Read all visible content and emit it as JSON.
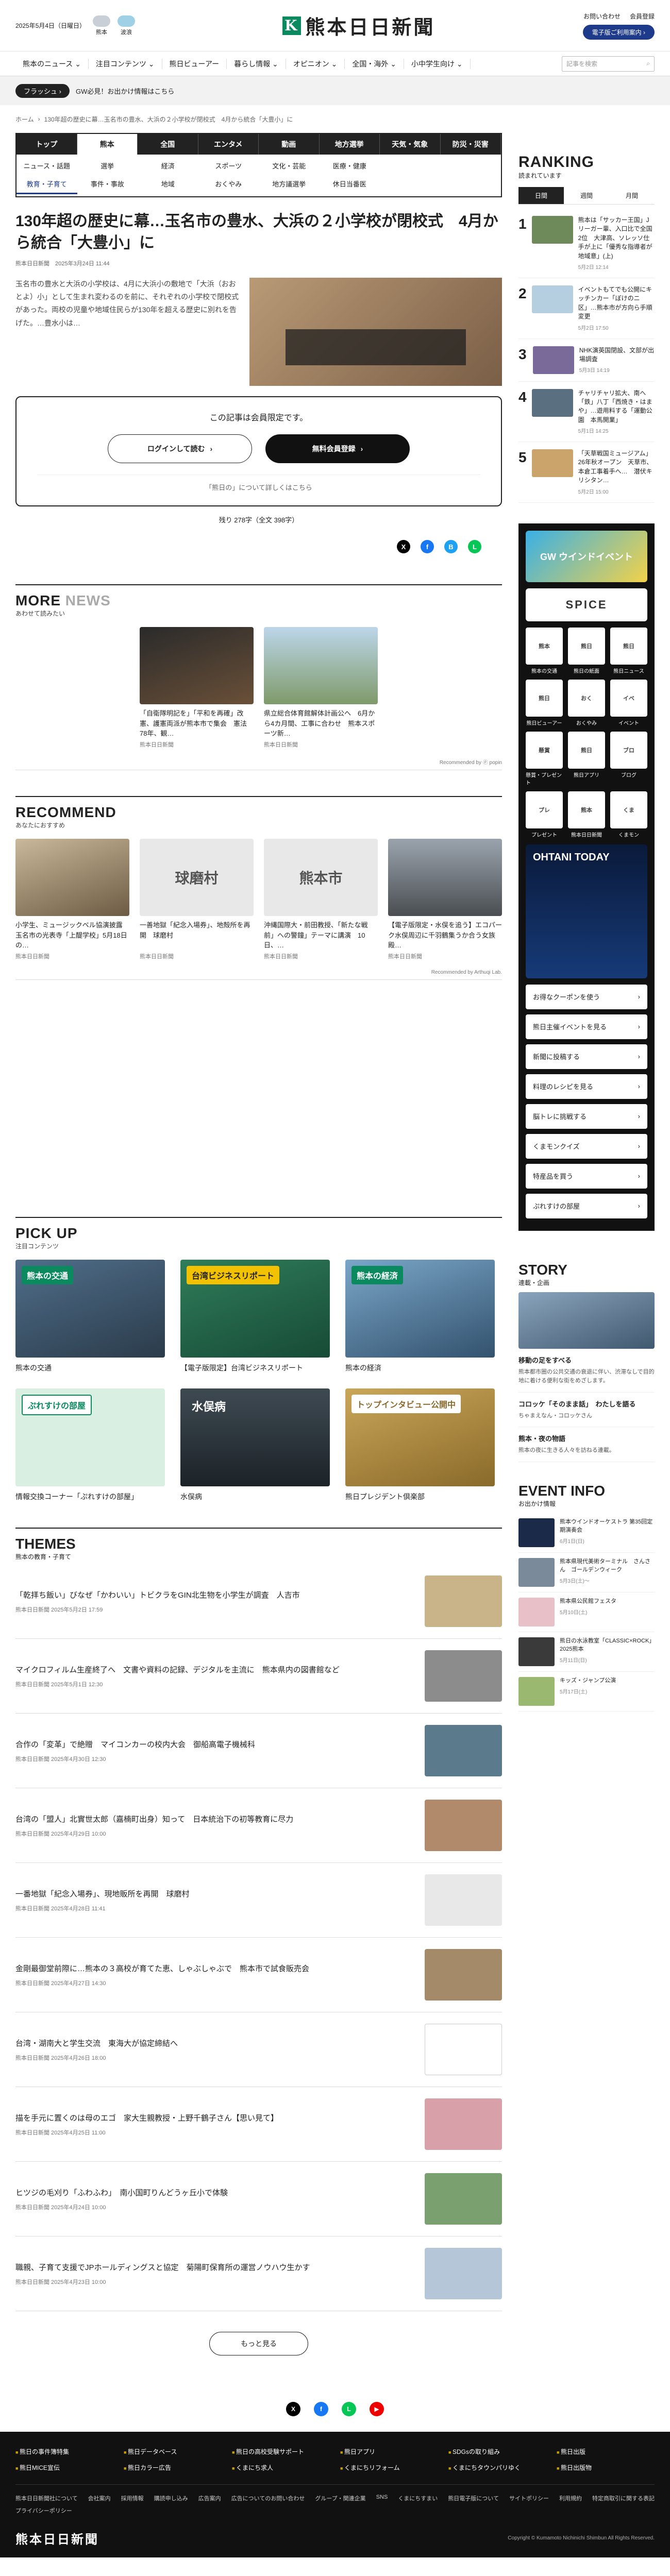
{
  "header": {
    "date": "2025年5月4日（日曜日）",
    "weather_label": "熊本",
    "weather2": "波浪",
    "logo_text": "熊本日日新聞",
    "links": [
      "お問い合わせ",
      "会員登録"
    ],
    "paper_btn": "電子版ご利用案内 ›"
  },
  "gnav": {
    "items": [
      "熊本のニュース ⌄",
      "注目コンテンツ ⌄",
      "熊日ビューアー",
      "暮らし情報 ⌄",
      "オピニオン ⌄",
      "全国・海外 ⌄",
      "小中学生向け ⌄"
    ],
    "search_placeholder": "記事を検索"
  },
  "flash": {
    "tag": "フラッシュ ›",
    "text": "GW必見！お出かけ情報はこちら"
  },
  "breadcrumb": [
    "ホーム",
    "130年超の歴史に幕…玉名市の豊水、大浜の２小学校が閉校式　4月から統合「大豊小」に"
  ],
  "category": {
    "top": [
      "トップ",
      "熊本",
      "全国",
      "エンタメ",
      "動画",
      "地方選挙",
      "天気・気象",
      "防災・災害"
    ],
    "sub": [
      "ニュース・話題",
      "選挙",
      "経済",
      "スポーツ",
      "文化・芸能",
      "医療・健康",
      "",
      "",
      "教育・子育て",
      "事件・事故",
      "地域",
      "おくやみ",
      "地方議選挙",
      "休日当番医"
    ]
  },
  "article": {
    "title": "130年超の歴史に幕…玉名市の豊水、大浜の２小学校が閉校式　4月から統合「大豊小」に",
    "meta": "熊本日日新聞　2025年3月24日 11:44",
    "lead": "玉名市の豊水と大浜の小学校は、4月に大浜小の敷地で「大浜（おおとよ）小」として生まれ変わるのを前に、それぞれの小学校で閉校式があった。両校の児童や地域住民らが130年を超える歴史に別れを告げた。…豊水小は…",
    "member_msg": "この記事は会員限定です。",
    "login_btn": "ログインして読む",
    "register_btn": "無料会員登録",
    "about_link": "「熊日の」について詳しくはこちら",
    "remaining": "残り 278字（全文 398字）"
  },
  "more_news": {
    "en": "MORE",
    "en2": "NEWS",
    "jp": "あわせて読みたい",
    "cards": [
      {
        "title": "「自衛隊明記を」「平和を再確」改憲、護憲両派が熊本市で集会　憲法78年、観…",
        "meta": "熊本日日新聞"
      },
      {
        "title": "県立総合体育館解体計画公へ　6月から4カ月間、工事に合わせ　熊本スポーツ新…",
        "meta": "熊本日日新聞"
      }
    ],
    "by": "Recommended by ⓟ popin"
  },
  "recommend": {
    "en": "RECOMMEND",
    "jp": "あなたにおすすめ",
    "cards": [
      {
        "title": "小学生、ミュージックベル協演披露　玉名市の光表寺「上醍学校」5月18日の…",
        "meta": "熊本日日新聞"
      },
      {
        "title": "一善地獄「紀念入場券」、地殻所を再開　球磨村",
        "meta": "熊本日日新聞"
      },
      {
        "title": "沖縄国際大・前田教授、「新たな戦前」への警鐘」テーマに講演　10日、…",
        "meta": "熊本日日新聞"
      },
      {
        "title": "【電子版限定・水俣を追う】エコパーク水俣周辺に千羽鶴集うか合う女族殿…",
        "meta": "熊本日日新聞"
      }
    ],
    "by": "Recommended by Arthuqi Lab."
  },
  "pickup": {
    "en": "PICK UP",
    "jp": "注目コンテンツ",
    "items": [
      {
        "label": "熊本の交通",
        "badge": "熊本の交通"
      },
      {
        "label": "【電子版限定】台湾ビジネスリポート",
        "badge": "台湾ビジネスリポート"
      },
      {
        "label": "熊本の経済",
        "badge": "熊本の経済"
      },
      {
        "label": "情報交換コーナー「ぷれすけの部屋」",
        "badge": "ぷれすけの部屋"
      },
      {
        "label": "水俣病",
        "badge": "水俣病"
      },
      {
        "label": "熊日プレジデント倶楽部",
        "badge": "トップインタビュー公開中"
      }
    ]
  },
  "themes": {
    "en": "THEMES",
    "jp": "熊本の教育・子育て",
    "items": [
      {
        "title": "「乾拝ち飯い」びなぜ「かわいい」トビクラをGIN北生物を小学生が調査　人吉市",
        "meta": "熊本日日新聞 2025年5月2日 17:59"
      },
      {
        "title": "マイクロフィルム生産終了へ　文書や資料の記録、デジタルを主流に　熊本県内の図書館など",
        "meta": "熊本日日新聞 2025年5月1日 12:30"
      },
      {
        "title": "合作の「変革」で絶贈　マイコンカーの校内大会　御船高電子機械科",
        "meta": "熊本日日新聞 2025年4月30日 12:30"
      },
      {
        "title": "台湾の「盟人」北實世太郎（嘉楠町出身）知って　日本統治下の初等教育に尽力",
        "meta": "熊本日日新聞 2025年4月29日 10:00"
      },
      {
        "title": "一番地獄「紀念入場券」、現地販所を再開　球磨村",
        "meta": "熊本日日新聞 2025年4月28日 11:41"
      },
      {
        "title": "金剛最御堂前際に…熊本の３高校が育てた恵、しゃぶしゃぶで　熊本市で試食販売会",
        "meta": "熊本日日新聞 2025年4月27日 14:30"
      },
      {
        "title": "台湾・湖南大と学生交流　東海大が協定締結へ",
        "meta": "熊本日日新聞 2025年4月26日 18:00"
      },
      {
        "title": "描を手元に置くのは母のエゴ　家大生親教授・上野千鶴子さん【思い見て】",
        "meta": "熊本日日新聞 2025年4月25日 11:00"
      },
      {
        "title": "ヒツジの毛刈り「ふわふわ」　南小国町りんどうヶ丘小で体験",
        "meta": "熊本日日新聞 2025年4月24日 10:00"
      },
      {
        "title": "職親、子育て支援でJPホールディングスと協定　菊陽町保育所の運営ノウハウ生かす",
        "meta": "熊本日日新聞 2025年4月23日 10:00"
      }
    ],
    "more_btn": "もっと見る"
  },
  "ranking": {
    "en": "RANKING",
    "jp": "読まれています",
    "tabs": [
      "日間",
      "週間",
      "月間"
    ],
    "items": [
      {
        "no": "1",
        "title": "熊本は「サッカー王国」Jリーガー輩、入口比で全国2位　大津高、ソレッソ仕手が上に「優秀な指導者が地域意」(上)",
        "date": "5月2日 12:14"
      },
      {
        "no": "2",
        "title": "イベントもてでも公開にキッチンカー「ぼけのニ区」…熊本市が方向ら手順変更",
        "date": "5月2日 17:50"
      },
      {
        "no": "3",
        "title": "NHK演英国閉設、文部が出場調査",
        "date": "5月3日 14:19"
      },
      {
        "no": "4",
        "title": "チャリチャリ拡大、南へ「鉄」八丁「西焼き・はまや」…遊用料する「運動公園　本馬開業」",
        "date": "5月1日 14:25"
      },
      {
        "no": "5",
        "title": "「天草戦国ミュージアム」26年秋オープン　天草市、本倉工事着手へ…　潜伏キリシタン…",
        "date": "5月2日 15:00"
      }
    ]
  },
  "side": {
    "gw_banner": "GW ウインドイベント",
    "icons": [
      "熊本の交通",
      "熊日の紙面",
      "熊日ニュース",
      "熊日ビューアー",
      "おくやみ",
      "イベント",
      "懸賞・プレゼント",
      "熊日アプリ",
      "ブログ",
      "プレゼント",
      "熊本日日新聞",
      "くまモン"
    ],
    "ohtani": "OHTANI TODAY",
    "links": [
      "お得なクーポンを使う",
      "熊日主催イベントを見る",
      "新聞に投稿する",
      "料理のレシピを見る",
      "脳トレに挑戦する",
      "くまモンクイズ",
      "特産品を買う",
      "ぷれすけの部屋"
    ]
  },
  "story": {
    "en": "STORY",
    "jp": "連載・企画",
    "items": [
      {
        "title": "移動の足をすべる",
        "desc": "熊本都市圏の公共交通の衰退に伴い、渋滞なしで目的地に着ける便利な街をめざします。"
      },
      {
        "title": "コロッケ「そのまま話」　わたしを語る",
        "desc": "ちゃまえなん・コロッケさん"
      },
      {
        "title": "熊本・夜の物語",
        "desc": "熊本の夜に生きる人々を訪ねる連載。"
      }
    ]
  },
  "events": {
    "en": "EVENT INFO",
    "jp": "お出かけ情報",
    "items": [
      {
        "title": "熊本ウインドオーケストラ 第35回定期演奏会",
        "date": "6月1日(日)"
      },
      {
        "title": "熊本県現代美術ターミナル　さんさん　ゴールデンウィーク",
        "date": "5月3日(土)〜"
      },
      {
        "title": "熊本県公民館フェスタ",
        "date": "5月10日(土)"
      },
      {
        "title": "熊日の水泳教室「CLASSIC×ROCK」2025熊本",
        "date": "5月11日(日)"
      },
      {
        "title": "キッズ・ジャンプ公演",
        "date": "5月17日(土)"
      }
    ]
  },
  "footer": {
    "grid": [
      "熊日の事件簿特集",
      "熊日データベース",
      "熊日の高校受験サポート",
      "熊日アプリ",
      "SDGsの取り組み",
      "熊日出版",
      "熊日MICE宣伝",
      "熊日カラー広告",
      "くまにち求人",
      "くまにちリフォーム",
      "くまにちタウンパリゆく",
      "熊日出版物"
    ],
    "links": [
      "熊本日日新聞社について",
      "会社案内",
      "採用情報",
      "購読申し込み",
      "広告案内",
      "広告についてのお問い合わせ",
      "グループ・関連企業",
      "SNS",
      "くまにちすまい",
      "熊日電子版について",
      "サイトポリシー",
      "利用規約",
      "特定商取引に関する表記",
      "プライバシーポリシー"
    ],
    "logo": "熊本日日新聞",
    "copyright": "Copyright © Kumamoto Nichinichi Shimbun All Rights Reserved."
  },
  "colors": {
    "brand": "#0a8a5e",
    "accent": "#1e3a8a",
    "dark": "#111111"
  }
}
